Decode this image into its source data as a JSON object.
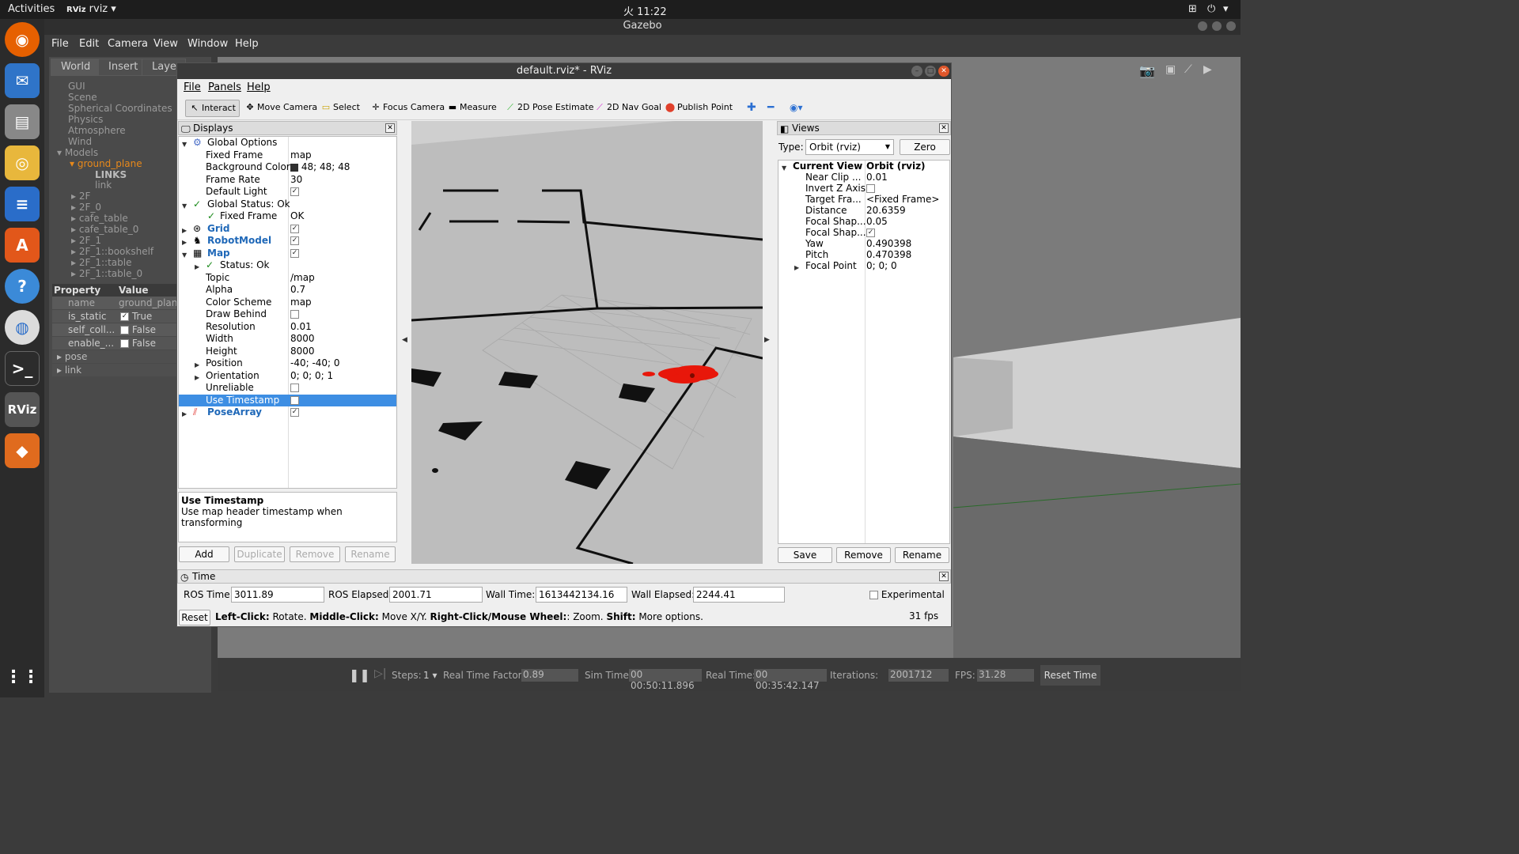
{
  "topbar": {
    "activities": "Activities",
    "app_name": "rviz",
    "clock": "火 11:22"
  },
  "gazebo": {
    "title": "Gazebo",
    "menu": [
      "File",
      "Edit",
      "Camera",
      "View",
      "Window",
      "Help"
    ],
    "tabs": [
      "World",
      "Insert",
      "Layer"
    ],
    "world_items": [
      "GUI",
      "Scene",
      "Spherical Coordinates",
      "Physics",
      "Atmosphere",
      "Wind",
      "Models"
    ],
    "model_selected": "ground_plane",
    "links_label": "LINKS",
    "link_label": "link",
    "models": [
      "2F",
      "2F_0",
      "cafe_table",
      "cafe_table_0",
      "2F_1",
      "2F_1::bookshelf",
      "2F_1::table",
      "2F_1::table_0"
    ],
    "props_header": {
      "property": "Property",
      "value": "Value"
    },
    "props": [
      {
        "k": "name",
        "v": "ground_plane"
      },
      {
        "k": "is_static",
        "v": "True"
      },
      {
        "k": "self_coll...",
        "v": "False"
      },
      {
        "k": "enable_...",
        "v": "False"
      },
      {
        "k": "pose",
        "v": ""
      },
      {
        "k": "link",
        "v": ""
      }
    ],
    "bottom": {
      "steps_label": "Steps:",
      "steps": "1",
      "rtf_label": "Real Time Factor:",
      "rtf": "0.89",
      "sim_label": "Sim Time:",
      "sim": "00 00:50:11.896",
      "real_label": "Real Time:",
      "real": "00 00:35:42.147",
      "iter_label": "Iterations:",
      "iter": "2001712",
      "fps_label": "FPS:",
      "fps": "31.28",
      "reset": "Reset Time"
    }
  },
  "rviz": {
    "title": "default.rviz* - RViz",
    "menu": [
      "File",
      "Panels",
      "Help"
    ],
    "tools": [
      "Interact",
      "Move Camera",
      "Select",
      "Focus Camera",
      "Measure",
      "2D Pose Estimate",
      "2D Nav Goal",
      "Publish Point"
    ],
    "displays": {
      "title": "Displays",
      "rows": [
        {
          "k": "Global Options",
          "v": ""
        },
        {
          "k": "Fixed Frame",
          "v": "map"
        },
        {
          "k": "Background Color",
          "v": "48; 48; 48"
        },
        {
          "k": "Frame Rate",
          "v": "30"
        },
        {
          "k": "Default Light",
          "v": ""
        },
        {
          "k": "Global Status: Ok",
          "v": ""
        },
        {
          "k": "Fixed Frame",
          "v": "OK"
        },
        {
          "k": "Grid",
          "v": ""
        },
        {
          "k": "RobotModel",
          "v": ""
        },
        {
          "k": "Map",
          "v": ""
        },
        {
          "k": "Status: Ok",
          "v": ""
        },
        {
          "k": "Topic",
          "v": "/map"
        },
        {
          "k": "Alpha",
          "v": "0.7"
        },
        {
          "k": "Color Scheme",
          "v": "map"
        },
        {
          "k": "Draw Behind",
          "v": ""
        },
        {
          "k": "Resolution",
          "v": "0.01"
        },
        {
          "k": "Width",
          "v": "8000"
        },
        {
          "k": "Height",
          "v": "8000"
        },
        {
          "k": "Position",
          "v": "-40; -40; 0"
        },
        {
          "k": "Orientation",
          "v": "0; 0; 0; 1"
        },
        {
          "k": "Unreliable",
          "v": ""
        },
        {
          "k": "Use Timestamp",
          "v": ""
        },
        {
          "k": "PoseArray",
          "v": ""
        }
      ],
      "desc_title": "Use Timestamp",
      "desc_text": "Use map header timestamp when transforming",
      "buttons": [
        "Add",
        "Duplicate",
        "Remove",
        "Rename"
      ]
    },
    "views": {
      "title": "Views",
      "type_label": "Type:",
      "type_value": "Orbit (rviz)",
      "zero": "Zero",
      "rows": [
        {
          "k": "Current View",
          "v": "Orbit (rviz)"
        },
        {
          "k": "Near Clip ...",
          "v": "0.01"
        },
        {
          "k": "Invert Z Axis",
          "v": ""
        },
        {
          "k": "Target Fra...",
          "v": "<Fixed Frame>"
        },
        {
          "k": "Distance",
          "v": "20.6359"
        },
        {
          "k": "Focal Shap...",
          "v": "0.05"
        },
        {
          "k": "Focal Shap...",
          "v": ""
        },
        {
          "k": "Yaw",
          "v": "0.490398"
        },
        {
          "k": "Pitch",
          "v": "0.470398"
        },
        {
          "k": "Focal Point",
          "v": "0; 0; 0"
        }
      ],
      "buttons": [
        "Save",
        "Remove",
        "Rename"
      ]
    },
    "time": {
      "title": "Time",
      "ros_time_label": "ROS Time:",
      "ros_time": "3011.89",
      "ros_elapsed_label": "ROS Elapsed:",
      "ros_elapsed": "2001.71",
      "wall_time_label": "Wall Time:",
      "wall_time": "1613442134.16",
      "wall_elapsed_label": "Wall Elapsed:",
      "wall_elapsed": "2244.41",
      "experimental": "Experimental",
      "reset": "Reset",
      "hint_lc": "Left-Click:",
      "hint_lc_t": "Rotate.",
      "hint_mc": "Middle-Click:",
      "hint_mc_t": "Move X/Y.",
      "hint_rc": "Right-Click/Mouse Wheel:",
      "hint_rc_t": ": Zoom.",
      "hint_sh": "Shift:",
      "hint_sh_t": "More options.",
      "fps": "31 fps"
    }
  }
}
